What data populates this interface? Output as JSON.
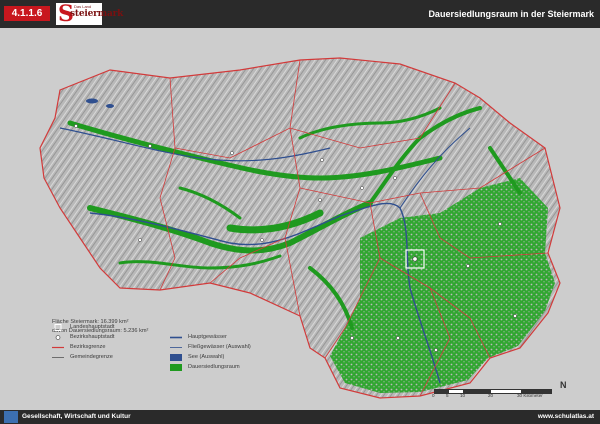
{
  "header": {
    "map_number": "4.1.1.6",
    "logo_letter": "S",
    "logo_word": "steiermark",
    "logo_sub": "Das Land",
    "title": "Dauersiedlungsraum in der Steiermark"
  },
  "colors": {
    "header_bg": "#2a2a2a",
    "accent_red": "#c8171e",
    "relief_bg": "#c9c9c9",
    "styria_relief": "#b4b4b4",
    "settlement_green": "#1f9a1f",
    "river_blue": "#2f4f8f",
    "border_red": "#d23a3a"
  },
  "map": {
    "area_info": {
      "total": "Fläche Steiermark: 16.399 km²",
      "settlement": "davon Dauersiedlungsraum: 5.236 km²"
    },
    "legend": [
      {
        "symbol": "circle-outline",
        "label": "Landeshauptstadt"
      },
      {
        "symbol": "circle-filled",
        "label": "Bezirkshauptstadt"
      },
      {
        "symbol": "line-red",
        "label": "Bezirksgrenze"
      },
      {
        "symbol": "line-dark",
        "label": "Gemeindegrenze"
      },
      {
        "symbol": "line-blue",
        "label": "Hauptgewässer"
      },
      {
        "symbol": "line-blue-thin",
        "label": "Fließgewässer (Auswahl)"
      },
      {
        "symbol": "fill-blue",
        "label": "See (Auswahl)"
      },
      {
        "symbol": "fill-green",
        "label": "Dauersiedlungsraum"
      }
    ],
    "scale": {
      "labels": [
        "0",
        "5",
        "10",
        "20",
        "30 Kilometer"
      ]
    },
    "north": "N"
  },
  "footer": {
    "section": "Gesellschaft, Wirtschaft und Kultur",
    "website": "www.schulatlas.at"
  }
}
